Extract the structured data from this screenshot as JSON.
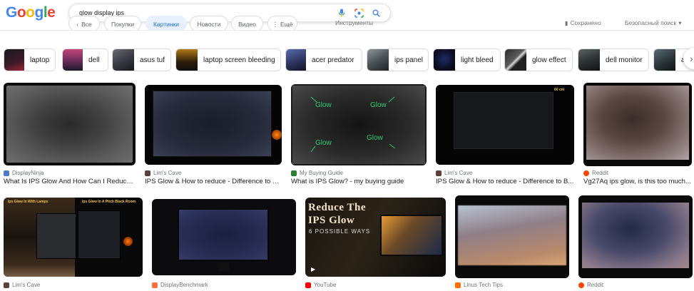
{
  "logo": [
    "G",
    "o",
    "o",
    "g",
    "l",
    "e"
  ],
  "logo_colors": [
    "#4285f4",
    "#ea4335",
    "#fbbc05",
    "#4285f4",
    "#34a853",
    "#ea4335"
  ],
  "search": {
    "value": "glow display ips"
  },
  "filters": {
    "all": "Все",
    "shopping": "Покупки",
    "images": "Картинки",
    "news": "Новости",
    "video": "Видео",
    "more": "Ещё",
    "tools": "Инструменты",
    "saved": "Сохранено",
    "safesearch": "Безопасный поиск"
  },
  "chips": [
    {
      "label": "laptop"
    },
    {
      "label": "dell"
    },
    {
      "label": "asus tuf"
    },
    {
      "label": "laptop screen bleeding"
    },
    {
      "label": "acer predator"
    },
    {
      "label": "ips panel"
    },
    {
      "label": "light bleed"
    },
    {
      "label": "glow effect"
    },
    {
      "label": "dell monitor"
    },
    {
      "label": "as"
    }
  ],
  "results_row1": [
    {
      "source": "DisplayNinja",
      "title": "What Is IPS Glow And How Can I Reduce ...",
      "fav": "#4a7bd0"
    },
    {
      "source": "Lim's Cave",
      "title": "IPS Glow & How to reduce - Difference to B...",
      "fav": "#5d4037"
    },
    {
      "source": "My Buying Guide",
      "title": "What is IPS Glow? - my buying guide",
      "fav": "#2e7d32",
      "glows": [
        "Glow",
        "Glow",
        "Glow",
        "Glow"
      ]
    },
    {
      "source": "Lim's Cave",
      "title": "IPS Glow & How to reduce - Difference to B...",
      "fav": "#5d4037",
      "badge": "60 cm"
    },
    {
      "source": "Reddit",
      "title": "Vg27Aq ips glow, is this too much...",
      "fav": "#ff4500"
    }
  ],
  "results_row2": [
    {
      "source": "Lim's Cave",
      "fav": "#5d4037",
      "labels": [
        "Ips Glow In With Lamps",
        "Ips Glow In A Pitch Black Room"
      ]
    },
    {
      "source": "DisplayBenchmark",
      "fav": "#ff7043"
    },
    {
      "source": "YouTube",
      "fav": "#ff0000",
      "heading": "Reduce The IPS Glow",
      "sub": "6 POSSIBLE WAYS"
    },
    {
      "source": "Linus Tech Tips",
      "fav": "#ff6f00"
    },
    {
      "source": "Reddit",
      "fav": "#ff4500"
    }
  ]
}
